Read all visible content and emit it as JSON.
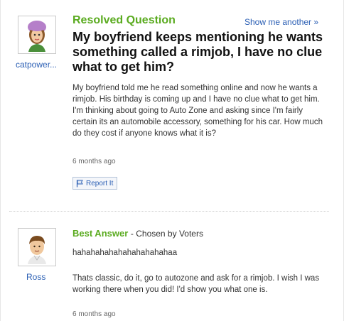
{
  "question": {
    "status_label": "Resolved Question",
    "show_another": "Show me another »",
    "asker_name": "catpower...",
    "title": "My boyfriend keeps mentioning he wants something called a rimjob, I have no clue what to get him?",
    "body": "My boyfriend told me he read something online and now he wants a rimjob. His birthday is coming up and I have no clue what to get him. I'm thinking about going to Auto Zone and asking since I'm fairly certain its an automobile accessory, something for his car. How much do they cost if anyone knows what it is?",
    "timestamp": "6 months ago",
    "report_label": "Report It"
  },
  "best_answer": {
    "label": "Best Answer",
    "chosen_by": "- Chosen by Voters",
    "answerer_name": "Ross",
    "first_line": "hahahahahahahahahahahaa",
    "body": "Thats classic, do it, go to autozone and ask for a rimjob. I wish I was working there when you did! I'd show you what one is.",
    "timestamp": "6 months ago"
  },
  "colors": {
    "accent_green": "#5aab1f",
    "link_blue": "#2b5fb4"
  },
  "icons": [
    "asker-avatar",
    "answerer-avatar",
    "flag-icon"
  ]
}
